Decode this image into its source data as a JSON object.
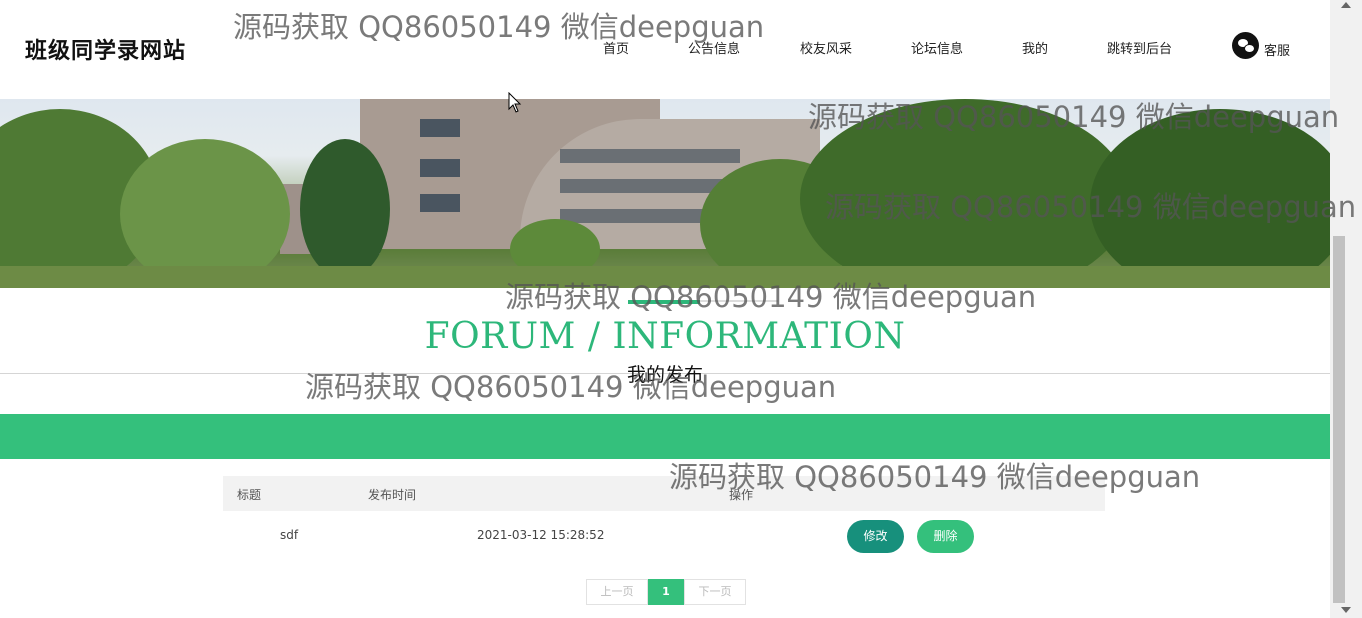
{
  "header": {
    "logo": "班级同学录网站",
    "nav": [
      "首页",
      "公告信息",
      "校友风采",
      "论坛信息",
      "我的",
      "跳转到后台"
    ],
    "service_label": "客服",
    "service_icon": "wechat-icon"
  },
  "forum": {
    "title": "FORUM / INFORMATION",
    "subtitle": "我的发布"
  },
  "table": {
    "headers": [
      "标题",
      "发布时间",
      "操作"
    ],
    "rows": [
      {
        "title": "sdf",
        "time": "2021-03-12 15:28:52",
        "edit": "修改",
        "delete": "删除"
      }
    ]
  },
  "pager": {
    "prev": "上一页",
    "current": "1",
    "next": "下一页"
  },
  "watermark": "源码获取 QQ86050149 微信deepguan",
  "colors": {
    "accent": "#34c07c",
    "edit_button": "#17907c"
  }
}
